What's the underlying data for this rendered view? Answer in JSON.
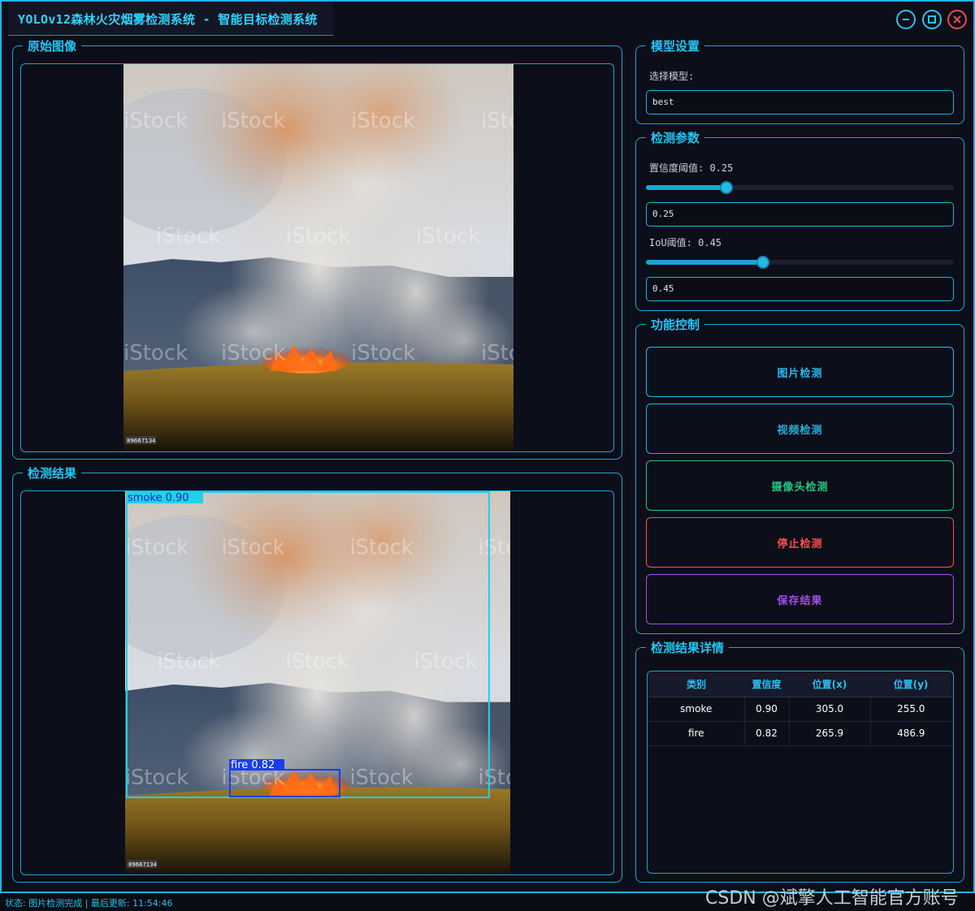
{
  "window": {
    "title": "YOLOv12森林火灾烟雾检测系统 - 智能目标检测系统"
  },
  "original_panel": {
    "title": "原始图像",
    "photo_watermark": "iStock",
    "photo_id": "89667134"
  },
  "result_panel": {
    "title": "检测结果",
    "detections": [
      {
        "label": "smoke 0.90",
        "color": "#1fd1e8"
      },
      {
        "label": "fire 0.82",
        "color": "#1a3df0"
      }
    ]
  },
  "model_settings": {
    "title": "模型设置",
    "select_label": "选择模型:",
    "selected_model": "best"
  },
  "detect_params": {
    "title": "检测参数",
    "confidence_label": "置信度阈值: 0.25",
    "confidence_value": "0.25",
    "confidence_level": 0.25,
    "iou_label": "IoU阈值: 0.45",
    "iou_value": "0.45",
    "iou_level": 0.45
  },
  "controls": {
    "title": "功能控制",
    "buttons": [
      {
        "label": "图片检测",
        "color": "#2ab8ee"
      },
      {
        "label": "视频检测",
        "color": "#22b2df"
      },
      {
        "label": "摄像头检测",
        "color": "#22c787"
      },
      {
        "label": "停止检测",
        "color": "#ff4d4d"
      },
      {
        "label": "保存结果",
        "color": "#a64bf0"
      }
    ]
  },
  "details": {
    "title": "检测结果详情",
    "columns": [
      "类别",
      "置信度",
      "位置(x)",
      "位置(y)"
    ],
    "rows": [
      [
        "smoke",
        "0.90",
        "305.0",
        "255.0"
      ],
      [
        "fire",
        "0.82",
        "265.9",
        "486.9"
      ]
    ]
  },
  "status": {
    "text": "状态: 图片检测完成 | 最后更新: 11:54:46"
  },
  "watermark": "CSDN @斌擎人工智能官方账号"
}
